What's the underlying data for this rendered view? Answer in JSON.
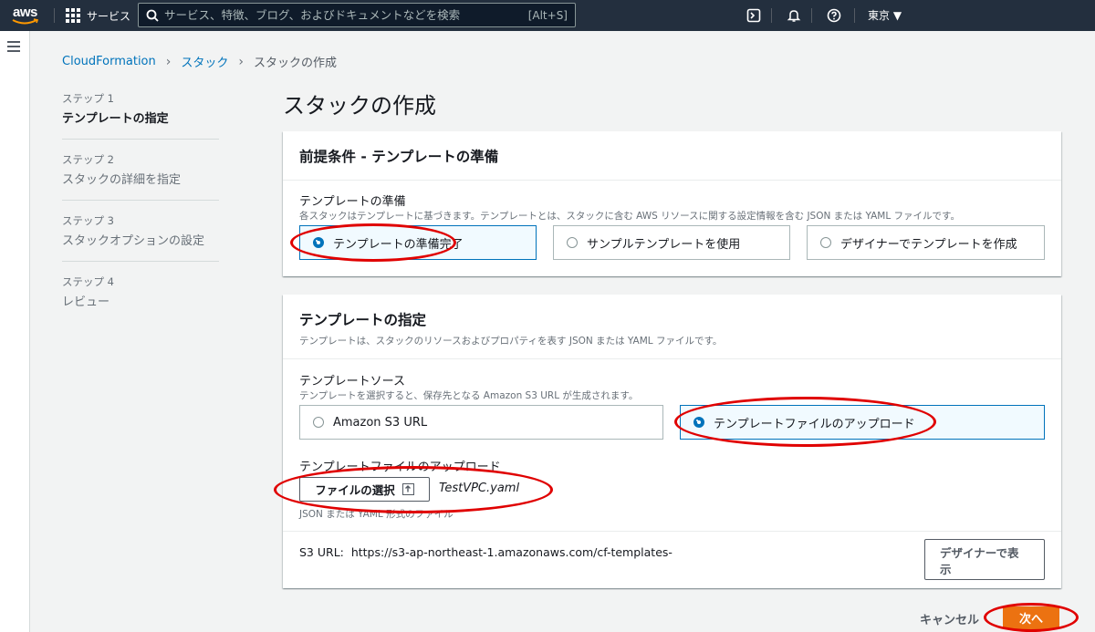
{
  "topnav": {
    "logo_text": "aws",
    "services_label": "サービス",
    "search_placeholder": "サービス、特徴、ブログ、およびドキュメントなどを検索",
    "search_shortcut": "[Alt+S]",
    "region": "東京 ▼",
    "icons": [
      "cloudshell-icon",
      "bell-icon",
      "help-icon"
    ]
  },
  "breadcrumb": {
    "items": [
      "CloudFormation",
      "スタック"
    ],
    "current": "スタックの作成"
  },
  "steps": [
    {
      "num": "ステップ 1",
      "label": "テンプレートの指定",
      "active": true
    },
    {
      "num": "ステップ 2",
      "label": "スタックの詳細を指定",
      "active": false
    },
    {
      "num": "ステップ 3",
      "label": "スタックオプションの設定",
      "active": false
    },
    {
      "num": "ステップ 4",
      "label": "レビュー",
      "active": false
    }
  ],
  "page_title": "スタックの作成",
  "prereq": {
    "title": "前提条件 - テンプレートの準備",
    "field_label": "テンプレートの準備",
    "field_desc": "各スタックはテンプレートに基づきます。テンプレートとは、スタックに含む AWS リソースに関する設定情報を含む JSON または YAML ファイルです。",
    "options": [
      "テンプレートの準備完了",
      "サンプルテンプレートを使用",
      "デザイナーでテンプレートを作成"
    ],
    "selected": "テンプレートの準備完了"
  },
  "specify": {
    "title": "テンプレートの指定",
    "desc": "テンプレートは、スタックのリソースおよびプロパティを表す JSON または YAML ファイルです。",
    "source_label": "テンプレートソース",
    "source_desc": "テンプレートを選択すると、保存先となる Amazon S3 URL が生成されます。",
    "options": [
      "Amazon S3 URL",
      "テンプレートファイルのアップロード"
    ],
    "selected": "テンプレートファイルのアップロード",
    "upload_label": "テンプレートファイルのアップロード",
    "file_button": "ファイルの選択",
    "file_name": "TestVPC.yaml",
    "file_hint": "JSON または YAML 形式のファイル",
    "s3_url_label": "S3 URL:",
    "s3_url": "https://s3-ap-northeast-1.amazonaws.com/cf-templates-",
    "designer_button": "デザイナーで表示"
  },
  "footer": {
    "cancel": "キャンセル",
    "next": "次へ"
  },
  "colors": {
    "nav_bg": "#232f3e",
    "link": "#0073bb",
    "primary": "#ec7211",
    "annotation": "#e00000"
  }
}
